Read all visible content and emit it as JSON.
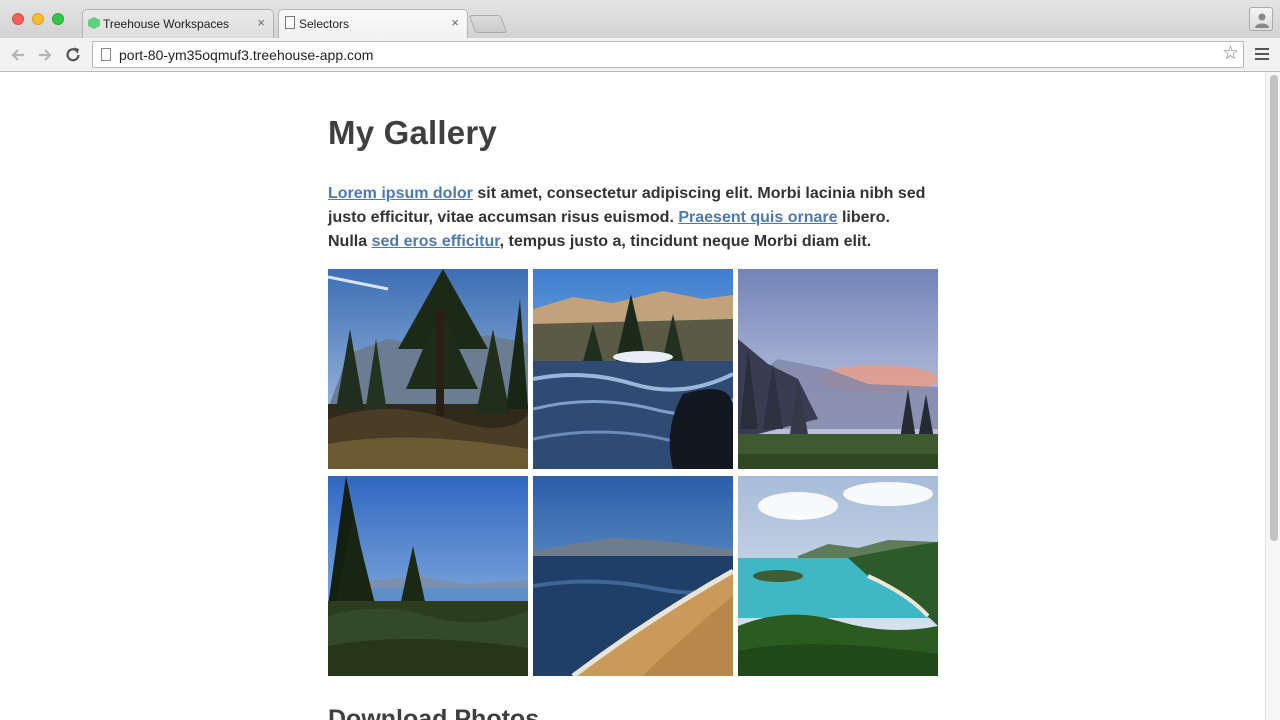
{
  "browser": {
    "tabs": [
      {
        "label": "Treehouse Workspaces",
        "close": "×",
        "active": false
      },
      {
        "label": "Selectors",
        "close": "×",
        "active": true
      }
    ],
    "address_bar": {
      "url": "port-80-ym35oqmuf3.treehouse-app.com"
    },
    "bookmark_icon": "star-icon"
  },
  "page": {
    "title": "My Gallery",
    "intro": {
      "link1": "Lorem ipsum dolor",
      "text1": " sit amet, consectetur adipiscing elit. Morbi lacinia nibh sed justo efficitur, vitae accumsan risus euismod. ",
      "link2": "Praesent quis ornare",
      "text2": " libero. Nulla ",
      "link3": "sed eros efficitur",
      "text3": ", tempus justo a, tincidunt neque Morbi diam elit."
    },
    "gallery": [
      {
        "name": "forest-lake-photo"
      },
      {
        "name": "river-rapids-photo"
      },
      {
        "name": "misty-meadow-photo"
      },
      {
        "name": "pine-lake-view-photo"
      },
      {
        "name": "sandy-beach-photo"
      },
      {
        "name": "tropical-bay-photo"
      }
    ],
    "section_heading": "Download Photos"
  },
  "colors": {
    "link": "#4a7ab5",
    "heading": "#3f3f3f",
    "body_text": "#333333"
  }
}
